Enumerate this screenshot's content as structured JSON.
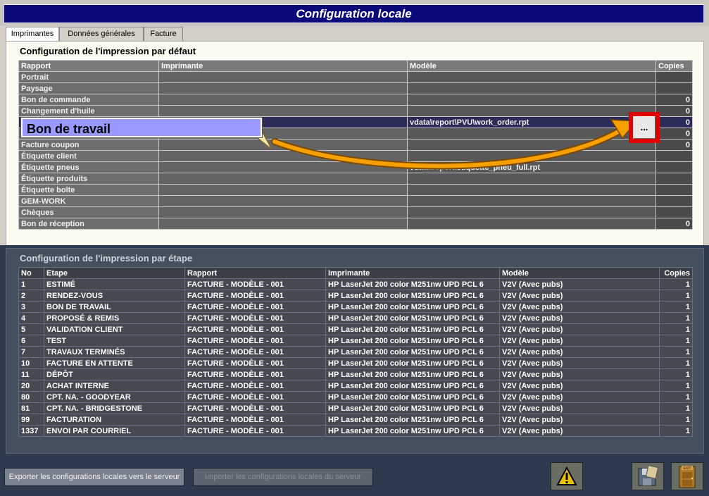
{
  "window": {
    "title": "Configuration locale"
  },
  "tabs": [
    {
      "label": "Imprimantes",
      "active": true
    },
    {
      "label": "Données générales",
      "active": false
    },
    {
      "label": "Facture",
      "active": false
    }
  ],
  "default_section": {
    "title": "Configuration de l'impression par défaut",
    "columns": [
      "Rapport",
      "Imprimante",
      "Modèle",
      "Copies"
    ],
    "rows": [
      {
        "rapport": "Portrait",
        "imprimante": "",
        "modele": "",
        "copies": ""
      },
      {
        "rapport": "Paysage",
        "imprimante": "",
        "modele": "",
        "copies": ""
      },
      {
        "rapport": "Bon de commande",
        "imprimante": "",
        "modele": "",
        "copies": "0"
      },
      {
        "rapport": "Changement d'huile",
        "imprimante": "",
        "modele": "",
        "copies": "0"
      },
      {
        "rapport": "",
        "imprimante": "",
        "modele": "vdata\\report\\PVU\\work_order.rpt",
        "copies": "0"
      },
      {
        "rapport": "",
        "imprimante": "",
        "modele": "",
        "copies": "0"
      },
      {
        "rapport": "Facture coupon",
        "imprimante": "",
        "modele": "",
        "copies": "0"
      },
      {
        "rapport": "Étiquette client",
        "imprimante": "",
        "modele": "",
        "copies": ""
      },
      {
        "rapport": "Étiquette pneus",
        "imprimante": "",
        "modele": "vdata\\report\\etiquette_pneu_full.rpt",
        "copies": ""
      },
      {
        "rapport": "Étiquette produits",
        "imprimante": "",
        "modele": "",
        "copies": ""
      },
      {
        "rapport": "Étiquette boîte",
        "imprimante": "",
        "modele": "",
        "copies": ""
      },
      {
        "rapport": "GEM-WORK",
        "imprimante": "",
        "modele": "",
        "copies": ""
      },
      {
        "rapport": "Chèques",
        "imprimante": "",
        "modele": "",
        "copies": ""
      },
      {
        "rapport": "Bon de réception",
        "imprimante": "",
        "modele": "",
        "copies": "0"
      }
    ],
    "callout_label": "Bon de travail",
    "browse_button_label": "..."
  },
  "step_section": {
    "title": "Configuration de l'impression par étape",
    "columns": [
      "No",
      "Etape",
      "Rapport",
      "Imprimante",
      "Modèle",
      "Copies"
    ],
    "rows": [
      {
        "no": "1",
        "etape": "ESTIMÉ",
        "rapport": "FACTURE - MODÈLE - 001",
        "imprimante": "HP LaserJet 200 color M251nw UPD PCL 6",
        "modele": "V2V (Avec pubs)",
        "copies": "1"
      },
      {
        "no": "2",
        "etape": "RENDEZ-VOUS",
        "rapport": "FACTURE - MODÈLE - 001",
        "imprimante": "HP LaserJet 200 color M251nw UPD PCL 6",
        "modele": "V2V (Avec pubs)",
        "copies": "1"
      },
      {
        "no": "3",
        "etape": "BON DE TRAVAIL",
        "rapport": "FACTURE - MODÈLE - 001",
        "imprimante": "HP LaserJet 200 color M251nw UPD PCL 6",
        "modele": "V2V (Avec pubs)",
        "copies": "1"
      },
      {
        "no": "4",
        "etape": "PROPOSÉ & REMIS",
        "rapport": "FACTURE - MODÈLE - 001",
        "imprimante": "HP LaserJet 200 color M251nw UPD PCL 6",
        "modele": "V2V (Avec pubs)",
        "copies": "1"
      },
      {
        "no": "5",
        "etape": "VALIDATION CLIENT",
        "rapport": "FACTURE - MODÈLE - 001",
        "imprimante": "HP LaserJet 200 color M251nw UPD PCL 6",
        "modele": "V2V (Avec pubs)",
        "copies": "1"
      },
      {
        "no": "6",
        "etape": "TEST",
        "rapport": "FACTURE - MODÈLE - 001",
        "imprimante": "HP LaserJet 200 color M251nw UPD PCL 6",
        "modele": "V2V (Avec pubs)",
        "copies": "1"
      },
      {
        "no": "7",
        "etape": "TRAVAUX TERMINÉS",
        "rapport": "FACTURE - MODÈLE - 001",
        "imprimante": "HP LaserJet 200 color M251nw UPD PCL 6",
        "modele": "V2V (Avec pubs)",
        "copies": "1"
      },
      {
        "no": "10",
        "etape": "FACTURE EN ATTENTE",
        "rapport": "FACTURE - MODÈLE - 001",
        "imprimante": "HP LaserJet 200 color M251nw UPD PCL 6",
        "modele": "V2V (Avec pubs)",
        "copies": "1"
      },
      {
        "no": "11",
        "etape": "DÉPÔT",
        "rapport": "FACTURE - MODÈLE - 001",
        "imprimante": "HP LaserJet 200 color M251nw UPD PCL 6",
        "modele": "V2V (Avec pubs)",
        "copies": "1"
      },
      {
        "no": "20",
        "etape": "ACHAT INTERNE",
        "rapport": "FACTURE - MODÈLE - 001",
        "imprimante": "HP LaserJet 200 color M251nw UPD PCL 6",
        "modele": "V2V (Avec pubs)",
        "copies": "1"
      },
      {
        "no": "80",
        "etape": "CPT. NA. - GOODYEAR",
        "rapport": "FACTURE - MODÈLE - 001",
        "imprimante": "HP LaserJet 200 color M251nw UPD PCL 6",
        "modele": "V2V (Avec pubs)",
        "copies": "1"
      },
      {
        "no": "81",
        "etape": "CPT. NA. - BRIDGESTONE",
        "rapport": "FACTURE - MODÈLE - 001",
        "imprimante": "HP LaserJet 200 color M251nw UPD PCL 6",
        "modele": "V2V (Avec pubs)",
        "copies": "1"
      },
      {
        "no": "99",
        "etape": "FACTURATION",
        "rapport": "FACTURE - MODÈLE - 001",
        "imprimante": "HP LaserJet 200 color M251nw UPD PCL 6",
        "modele": "V2V (Avec pubs)",
        "copies": "1"
      },
      {
        "no": "1337",
        "etape": "ENVOI PAR COURRIEL",
        "rapport": "FACTURE - MODÈLE - 001",
        "imprimante": "HP LaserJet 200 color M251nw UPD PCL 6",
        "modele": "V2V (Avec pubs)",
        "copies": "1"
      }
    ]
  },
  "footer": {
    "export_label": "Exporter les configurations locales vers le serveur",
    "import_label": "Importer les configurations locales du serveur",
    "exit_label": "EXIT"
  },
  "colors": {
    "title_bar": "#0a0a7a",
    "callout": "#9999ff",
    "arrow": "#f5a000",
    "highlight": "#e00000"
  },
  "icons": [
    "warning-icon",
    "save-icon",
    "exit-door-icon",
    "ellipsis-icon"
  ]
}
